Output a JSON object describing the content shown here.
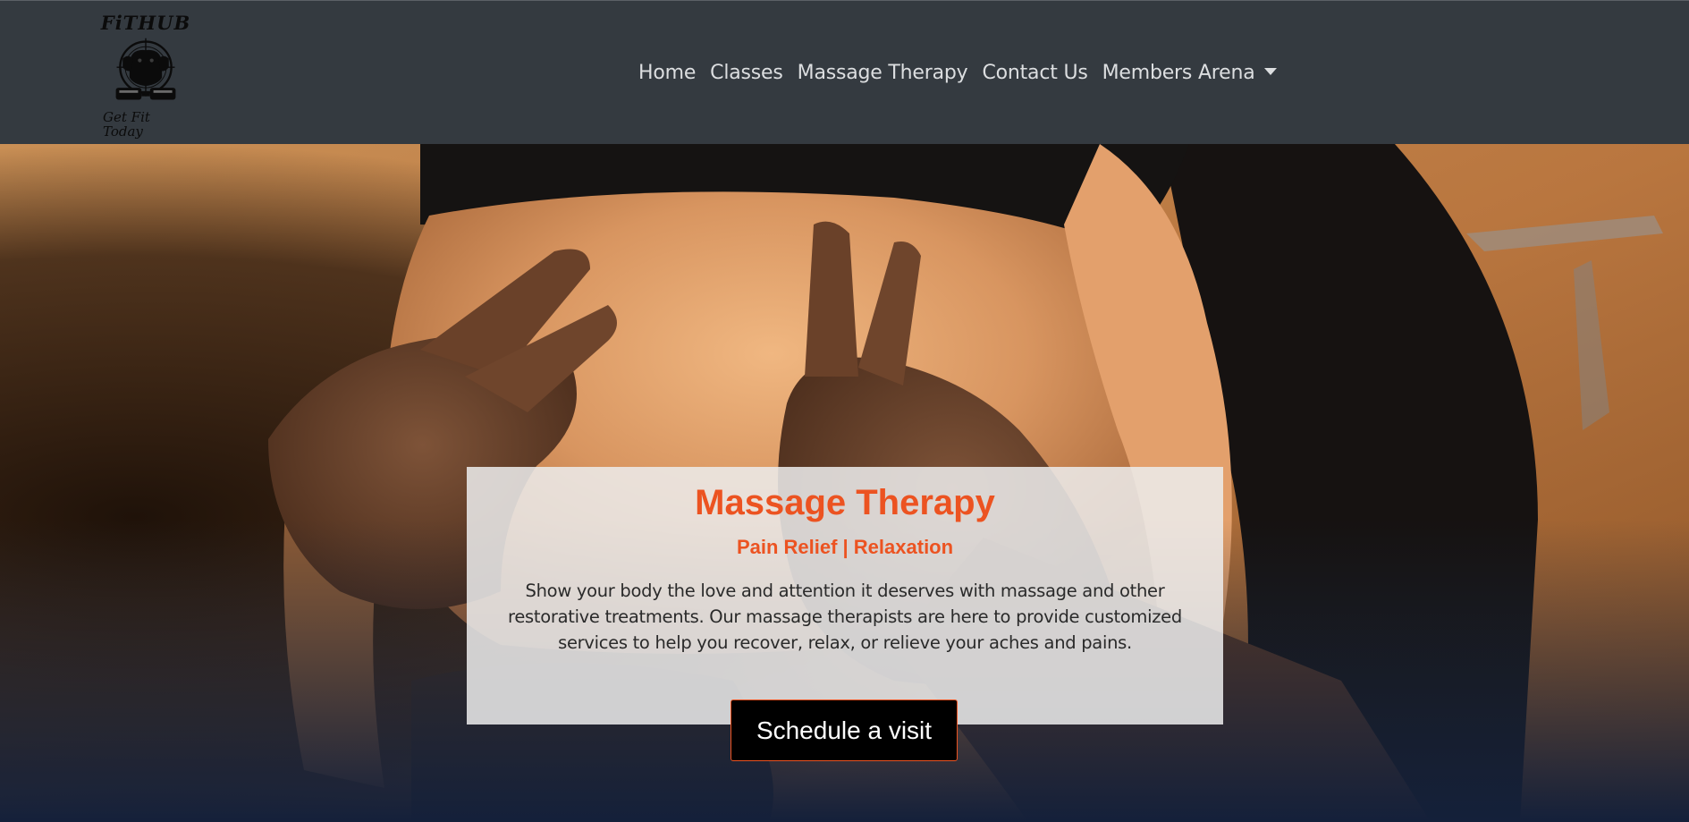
{
  "brand": {
    "name": "FiTHUB",
    "tagline": "Get Fit Today"
  },
  "nav": {
    "items": [
      {
        "label": "Home"
      },
      {
        "label": "Classes"
      },
      {
        "label": "Massage Therapy"
      },
      {
        "label": "Contact Us"
      },
      {
        "label": "Members Arena",
        "has_dropdown": true
      }
    ]
  },
  "hero": {
    "title": "Massage Therapy",
    "subtitle": "Pain Relief | Relaxation",
    "description": "Show your body the love and attention it deserves with massage and other restorative treatments. Our massage therapists are here to provide customized services to help you recover, relax, or relieve your aches and pains.",
    "cta_label": "Schedule a visit"
  },
  "colors": {
    "navbar_bg": "#343a40",
    "nav_text": "#dcdee0",
    "accent": "#ec5321",
    "card_bg": "rgba(236,236,236,0.86)",
    "button_bg": "#000000"
  },
  "icons": [
    "fithub-logo-emblem",
    "chevron-down-icon"
  ]
}
